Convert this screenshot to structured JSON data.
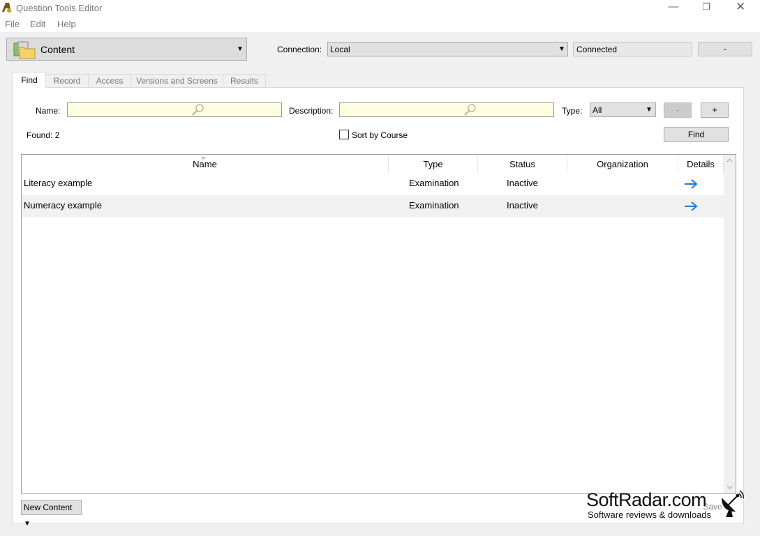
{
  "window": {
    "title": "Question Tools Editor",
    "minimize": "—",
    "maximize": "❐",
    "close": "✕"
  },
  "menu": {
    "items": [
      "File",
      "Edit",
      "Help"
    ]
  },
  "toolbar": {
    "content_label": "Content",
    "connection_label": "Connection:",
    "connection_value": "Local",
    "status_value": "Connected",
    "disconnect_label": "-"
  },
  "tabs": [
    {
      "label": "Find",
      "active": true
    },
    {
      "label": "Record"
    },
    {
      "label": "Access"
    },
    {
      "label": "Versions and Screens"
    },
    {
      "label": "Results"
    }
  ],
  "find": {
    "name_label": "Name:",
    "name_value": "",
    "description_label": "Description:",
    "description_value": "",
    "type_label": "Type:",
    "type_value": "All",
    "minus_label": "-",
    "plus_label": "+",
    "found_text": "Found: 2",
    "sort_by_course_label": "Sort by Course",
    "find_label": "Find"
  },
  "table": {
    "columns": [
      "Name",
      "Type",
      "Status",
      "Organization",
      "Details"
    ],
    "rows": [
      {
        "name": "Literacy example",
        "type": "Examination",
        "status": "Inactive",
        "organization": ""
      },
      {
        "name": "Numeracy example",
        "type": "Examination",
        "status": "Inactive",
        "organization": ""
      }
    ],
    "sort_indicator": "^"
  },
  "footer": {
    "new_content_label": "New Content",
    "save_label": "Save"
  },
  "watermark": {
    "title": "SoftRadar.com",
    "subtitle": "Software reviews & downloads"
  },
  "colors": {
    "accent_arrow": "#1e78d2",
    "search_field_bg": "#fffde0"
  }
}
